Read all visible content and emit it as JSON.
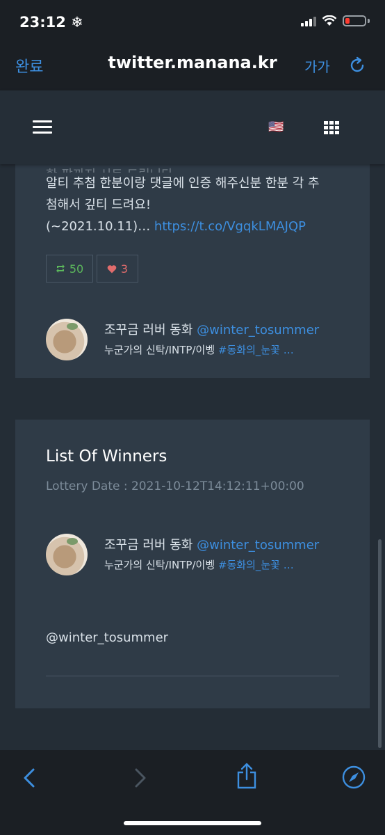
{
  "status": {
    "time": "23:12",
    "time_glyph": "❄"
  },
  "browser": {
    "done_label": "완료",
    "url": "twitter.manana.kr",
    "text_size_label": "가가"
  },
  "header": {
    "flag": "🇺🇸"
  },
  "tweet": {
    "partial_line": "한 팝까지 시트 드립니다",
    "line1": "알티 추첨 한분이랑 댓글에 인증 해주신분 한분 각 추",
    "line2": "첨해서 깊티 드려요!",
    "line3_prefix": "(~2021.10.11)… ",
    "link": "https://t.co/VgqkLMAJQP",
    "retweets": "50",
    "likes": "3"
  },
  "user": {
    "name": "조꾸금 러버 동화",
    "handle": "@winter_tosummer",
    "bio_prefix": "누군가의 신탁/INTP/이벵 ",
    "bio_hashtag": "#동화의_눈꽃 …"
  },
  "winners": {
    "title": "List Of Winners",
    "lottery_date": "Lottery Date : 2021-10-12T14:12:11+00:00",
    "winner_handle": "@winter_tosummer"
  },
  "colors": {
    "accent": "#3d8fe0",
    "retweet": "#5cb85c",
    "like": "#e06c6c"
  }
}
